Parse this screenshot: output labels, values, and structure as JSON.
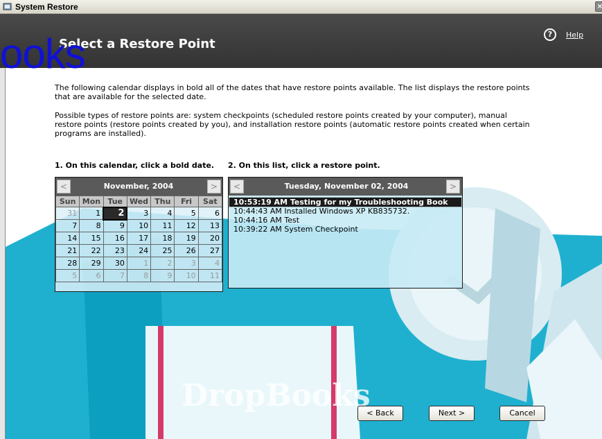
{
  "window": {
    "title": "System Restore"
  },
  "header": {
    "title": "Select a Restore Point",
    "help_label": "Help"
  },
  "watermark": {
    "fragment": "ooks",
    "bottom_text": "DropBooks"
  },
  "intro": {
    "p1": "The following calendar displays in bold all of the dates that have restore points available. The list displays the restore points that are available for the selected date.",
    "p2": "Possible types of restore points are: system checkpoints (scheduled restore points created by your computer), manual restore points (restore points created by you), and installation restore points (automatic restore points created when certain programs are installed)."
  },
  "steps": {
    "step1": "1. On this calendar, click a bold date.",
    "step2": "2. On this list, click a restore point."
  },
  "calendar": {
    "month_label": "November, 2004",
    "prev": "<",
    "next": ">",
    "weekdays": [
      "Sun",
      "Mon",
      "Tue",
      "Wed",
      "Thu",
      "Fri",
      "Sat"
    ],
    "weeks": [
      [
        "31",
        "1",
        "2",
        "3",
        "4",
        "5",
        "6"
      ],
      [
        "7",
        "8",
        "9",
        "10",
        "11",
        "12",
        "13"
      ],
      [
        "14",
        "15",
        "16",
        "17",
        "18",
        "19",
        "20"
      ],
      [
        "21",
        "22",
        "23",
        "24",
        "25",
        "26",
        "27"
      ],
      [
        "28",
        "29",
        "30",
        "1",
        "2",
        "3",
        "4"
      ],
      [
        "5",
        "6",
        "7",
        "8",
        "9",
        "10",
        "11"
      ]
    ],
    "selected": "2"
  },
  "restore_list": {
    "date_label": "Tuesday, November 02, 2004",
    "prev": "<",
    "next": ">",
    "items": [
      "10:53:19 AM  Testing for my Troubleshooting Book",
      "10:44:43 AM  Installed Windows XP KB835732.",
      "10:44:16 AM  Test",
      "10:39:22 AM  System Checkpoint"
    ]
  },
  "buttons": {
    "back": "< Back",
    "next": "Next >",
    "cancel": "Cancel"
  },
  "colors": {
    "header_bg": "#3c3c3c",
    "watermark_teal": "#17a6c8",
    "watermark_blue": "#1010d8"
  }
}
